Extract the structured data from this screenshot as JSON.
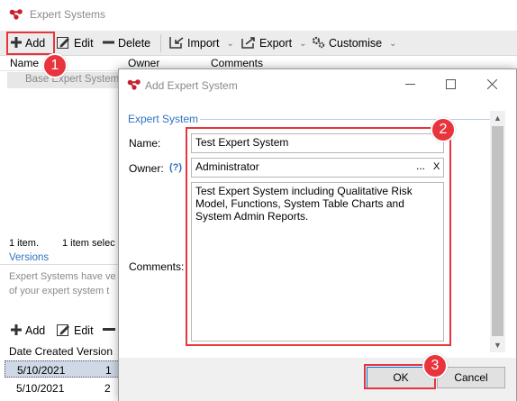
{
  "bg_window": {
    "title": "Expert Systems",
    "toolbar": {
      "add_label": "Add",
      "edit_label": "Edit",
      "delete_label": "Delete",
      "import_label": "Import",
      "export_label": "Export",
      "customise_label": "Customise"
    },
    "grid_columns": [
      "Name",
      "Owner",
      "Comments"
    ],
    "grid_rows": [
      {
        "name": "Base Expert System"
      }
    ],
    "status": {
      "count": "1 item.",
      "selected": "1 item selec"
    },
    "versions_tab": "Versions",
    "versions_desc": [
      "Expert Systems have ve",
      "of your expert system t"
    ],
    "toolbar2": {
      "add_label": "Add",
      "edit_label": "Edit"
    },
    "versions_columns": [
      "Date Created",
      "Version"
    ],
    "versions_rows": [
      {
        "date": "5/10/2021",
        "version": "1"
      },
      {
        "date": "5/10/2021",
        "version": "2"
      }
    ]
  },
  "dialog": {
    "title": "Add Expert System",
    "group_title": "Expert System",
    "name_label": "Name:",
    "name_value": "Test Expert System",
    "owner_label": "Owner:",
    "owner_help": "(?)",
    "owner_value": "Administrator",
    "owner_browse": "...",
    "owner_clear": "X",
    "comments_label": "Comments:",
    "comments_value": "Test Expert System including Qualitative Risk Model, Functions, System Table Charts and System Admin Reports.",
    "ok_label": "OK",
    "cancel_label": "Cancel"
  },
  "annotations": {
    "step1": "1",
    "step2": "2",
    "step3": "3"
  },
  "colors": {
    "accent": "#e8353d",
    "link": "#2f74c0"
  }
}
